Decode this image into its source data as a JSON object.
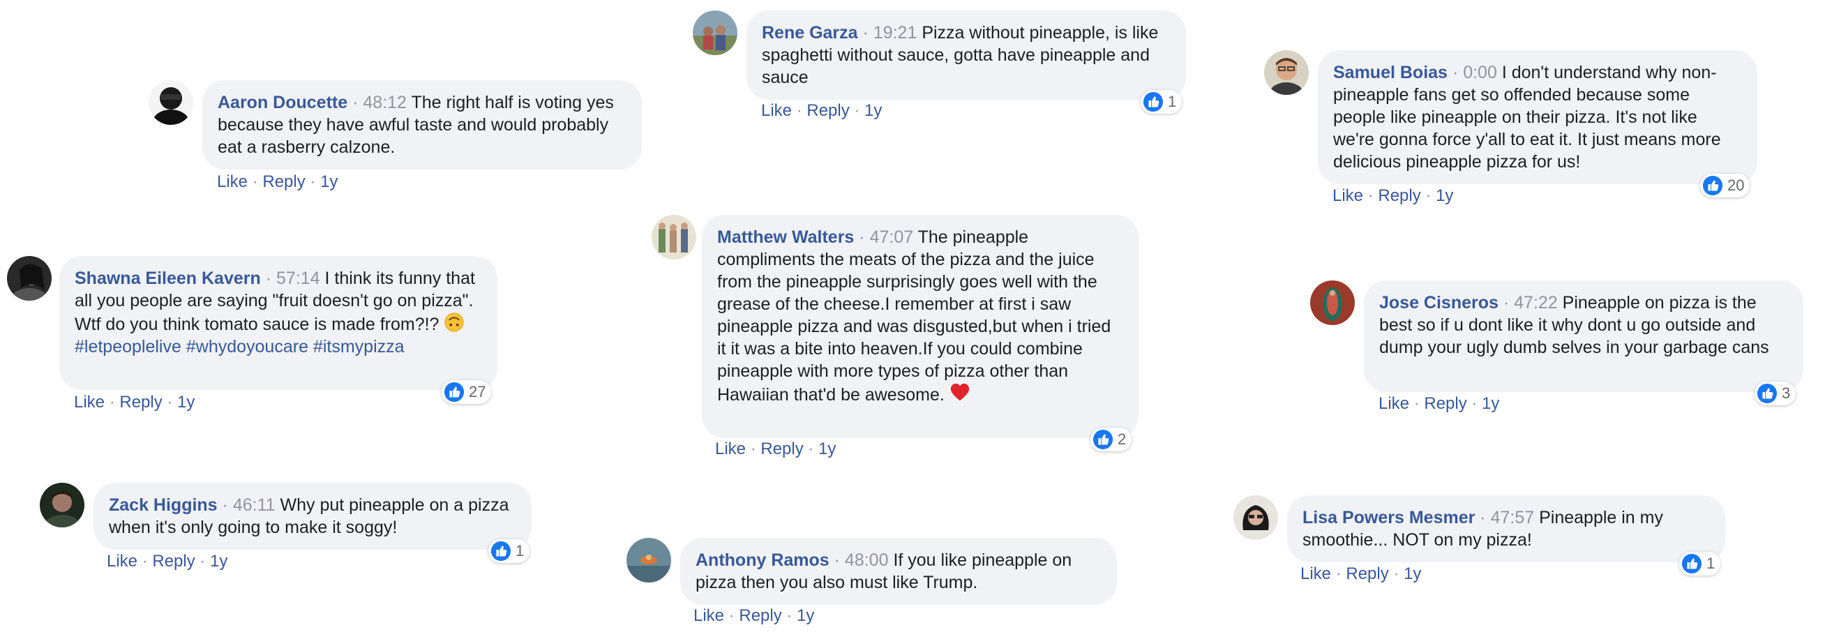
{
  "ui": {
    "like": "Like",
    "reply": "Reply",
    "dot": "·",
    "age": "1y"
  },
  "comments": [
    {
      "author": "Aaron Doucette",
      "timestamp": "48:12",
      "text": "The right half is voting yes because they have awful taste and would probably eat a rasberry calzone.",
      "likes": null
    },
    {
      "author": "Rene Garza",
      "timestamp": "19:21",
      "text": "Pizza without pineapple, is like spaghetti without sauce, gotta have pineapple and sauce",
      "likes": "1"
    },
    {
      "author": "Samuel Boias",
      "timestamp": "0:00",
      "text": "I don't understand why non-pineapple fans get so offended because some people like pineapple on their pizza. It's not like we're gonna force y'all to eat it. It just means more delicious pineapple pizza for us!",
      "likes": "20"
    },
    {
      "author": "Shawna Eileen Kavern",
      "timestamp": "57:14",
      "text": "I think its funny that all you people are saying \"fruit doesn't go on pizza\". Wtf do you think tomato sauce is made from?!?",
      "hashtags": [
        "#letpeoplelive",
        "#whydoyoucare",
        "#itsmypizza"
      ],
      "emoji": "upside-down-face-emoji",
      "likes": "27"
    },
    {
      "author": "Matthew Walters",
      "timestamp": "47:07",
      "text": "The pineapple compliments the meats of the pizza and the juice from the pineapple surprisingly goes well with the grease of the cheese.I remember at first i saw pineapple pizza and was disgusted,but when i tried it it was a bite into heaven.If you could combine pineapple with more types of pizza other than Hawaiian that'd be awesome.",
      "emoji": "red-heart-emoji",
      "likes": "2"
    },
    {
      "author": "Jose Cisneros",
      "timestamp": "47:22",
      "text": "Pineapple on pizza is the best so if u dont like it why dont u go outside and dump your ugly dumb selves in your garbage cans",
      "likes": "3"
    },
    {
      "author": "Zack Higgins",
      "timestamp": "46:11",
      "text": "Why put pineapple on a pizza when it's only going to make it soggy!",
      "likes": "1"
    },
    {
      "author": "Anthony Ramos",
      "timestamp": "48:00",
      "text": "If you like pineapple on pizza then you also must like Trump.",
      "likes": null
    },
    {
      "author": "Lisa Powers Mesmer",
      "timestamp": "47:57",
      "text": "Pineapple in my smoothie... NOT on my pizza!",
      "likes": "1"
    }
  ],
  "colors": {
    "bubble": "#f0f2f5",
    "author": "#385898",
    "timestamp": "#90949c",
    "like_blue": "#1877f2"
  }
}
